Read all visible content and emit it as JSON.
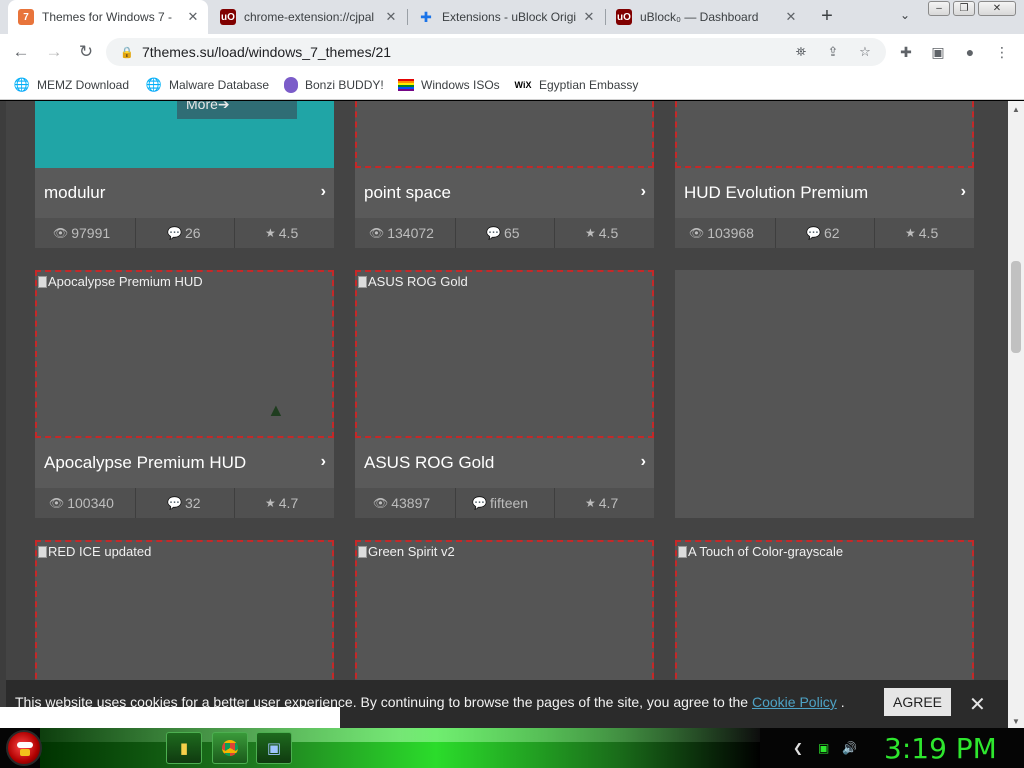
{
  "browser": {
    "tabs": [
      {
        "title": "Themes for Windows 7 -",
        "favicon": "7",
        "favicon_bg": "#e8743b",
        "active": true
      },
      {
        "title": "chrome-extension://cjpal",
        "favicon": "uO",
        "favicon_bg": "#800000",
        "active": false
      },
      {
        "title": "Extensions - uBlock Origi",
        "favicon": "puzzle",
        "favicon_bg": "#1a73e8",
        "active": false
      },
      {
        "title": "uBlock₀ — Dashboard",
        "favicon": "uO",
        "favicon_bg": "#800000",
        "active": false
      }
    ],
    "new_tab_symbol": "+",
    "url": "7themes.su/load/windows_7_themes/21",
    "bookmarks": [
      {
        "label": "MEMZ Download",
        "icon": "globe-icon"
      },
      {
        "label": "Malware Database",
        "icon": "globe-icon"
      },
      {
        "label": "Bonzi BUDDY!",
        "icon": "bonzi-icon"
      },
      {
        "label": "Windows ISOs",
        "icon": "rainbow-flag-icon"
      },
      {
        "label": "Egyptian Embassy",
        "icon": "wix-icon",
        "icon_text": "WiX"
      }
    ]
  },
  "page": {
    "more_label": "More➔",
    "cards": [
      {
        "name": "modulur",
        "views": "97991",
        "comments": "26",
        "rating": "4.5",
        "thumb": "teal"
      },
      {
        "name": "point space",
        "views": "134072",
        "comments": "65",
        "rating": "4.5",
        "thumb": "broken"
      },
      {
        "name": "HUD Evolution Premium",
        "views": "103968",
        "comments": "62",
        "rating": "4.5",
        "thumb": "broken"
      },
      {
        "name": "Apocalypse Premium HUD",
        "alt": "Apocalypse Premium HUD",
        "views": "100340",
        "comments": "32",
        "rating": "4.7"
      },
      {
        "name": "ASUS ROG Gold",
        "alt": "ASUS ROG Gold",
        "views": "43897",
        "comments": "fifteen",
        "rating": "4.7"
      },
      {
        "alt": "RED ICE updated"
      },
      {
        "alt": "Green Spirit v2"
      },
      {
        "alt": "A Touch of Color-grayscale"
      }
    ]
  },
  "cookie": {
    "text": "This website uses cookies for a better user experience. By continuing to browse the pages of the site, you agree to the ",
    "link": "Cookie Policy",
    "suffix": " .",
    "agree": "AGREE",
    "close": "✕"
  },
  "taskbar": {
    "clock": "3:19 PM"
  },
  "colors": {
    "accent_teal": "#20a5a6",
    "clock_green": "#2ee62e",
    "thumb_border": "#c62828"
  }
}
